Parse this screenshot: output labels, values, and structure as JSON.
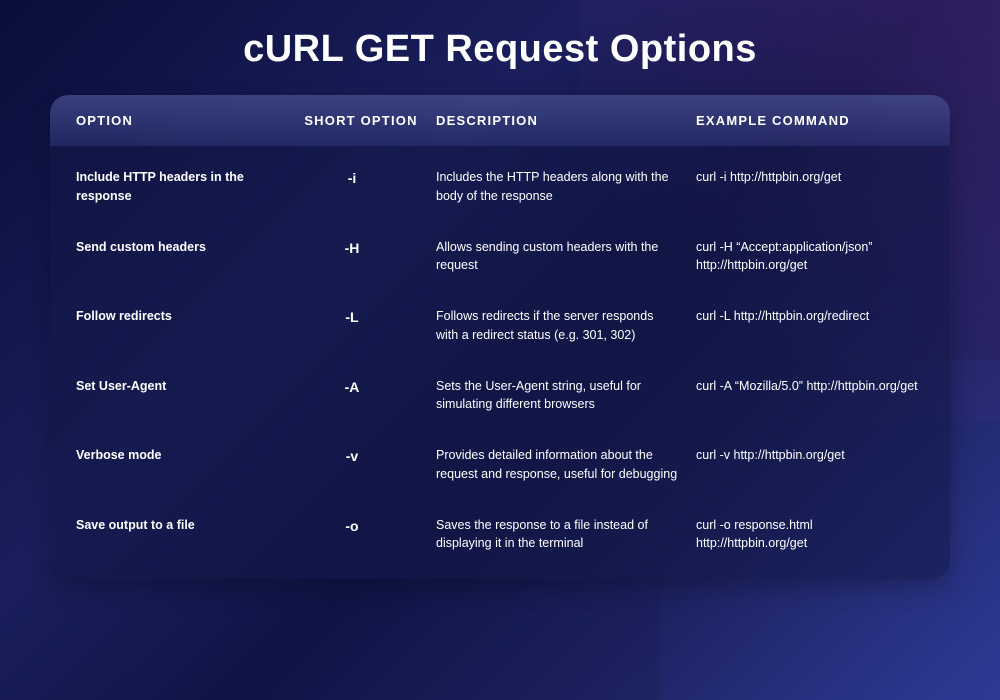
{
  "title": "cURL GET Request Options",
  "columns": {
    "option": "OPTION",
    "short": "SHORT OPTION",
    "description": "DESCRIPTION",
    "example": "EXAMPLE COMMAND"
  },
  "rows": [
    {
      "option": "Include HTTP headers in the response",
      "short": "-i",
      "description": "Includes the HTTP headers along with the body of the response",
      "example": "curl -i http://httpbin.org/get"
    },
    {
      "option": "Send custom headers",
      "short": "-H",
      "description": "Allows sending custom headers with the request",
      "example": "curl -H “Accept:application/json” http://httpbin.org/get"
    },
    {
      "option": "Follow redirects",
      "short": "-L",
      "description": "Follows redirects if the server responds with a redirect status (e.g. 301, 302)",
      "example": "curl -L http://httpbin.org/redirect"
    },
    {
      "option": "Set User-Agent",
      "short": "-A",
      "description": "Sets the User-Agent string, useful for simulating different browsers",
      "example": "curl -A “Mozilla/5.0” http://httpbin.org/get"
    },
    {
      "option": "Verbose mode",
      "short": "-v",
      "description": "Provides detailed information about the request and response, useful for debugging",
      "example": "curl -v http://httpbin.org/get"
    },
    {
      "option": "Save output to a file",
      "short": "-o",
      "description": "Saves the response to a file instead of displaying it in the terminal",
      "example": "curl -o response.html http://httpbin.org/get"
    }
  ]
}
